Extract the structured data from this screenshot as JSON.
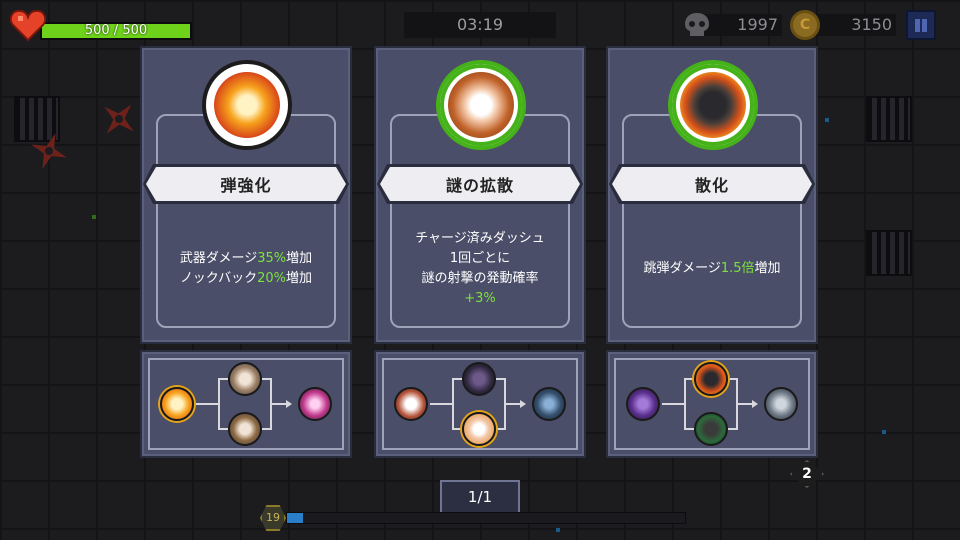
{
  "hud": {
    "hp_text": "500 / 500",
    "hp_fraction": 1.0,
    "timer": "03:19",
    "kills": "1997",
    "coins": "3150",
    "level": "19",
    "xp_fraction": 0.04
  },
  "colors": {
    "hp_green": "#6ed21b",
    "highlight_green": "#7de23c",
    "panel": "#4a4e68",
    "banner": "#eeeef2",
    "xp_blue": "#2a7fc8"
  },
  "cards": [
    {
      "title": "弾強化",
      "icon": "fist-explosion-icon",
      "desc_lines": [
        [
          {
            "t": "武器ダメージ"
          },
          {
            "t": "35%",
            "hl": true
          },
          {
            "t": "増加"
          }
        ],
        [
          {
            "t": "ノックバック"
          },
          {
            "t": "20%",
            "hl": true
          },
          {
            "t": "増加"
          }
        ]
      ],
      "evolution": {
        "from": "fist-explosion-icon",
        "mid_top": "brick-cat-icon",
        "mid_bottom": "cat-sword-icon",
        "result": "pink-slash-icon"
      }
    },
    {
      "title": "謎の拡散",
      "icon": "mystery-cat-icon",
      "desc_lines": [
        [
          {
            "t": "チャージ済みダッシュ"
          }
        ],
        [
          {
            "t": "1回ごとに"
          }
        ],
        [
          {
            "t": "謎の射撃の発動確率"
          }
        ],
        [
          {
            "t": "+3%",
            "hl": true
          }
        ]
      ],
      "evolution": {
        "from": "cat-gun-icon",
        "mid_top": "shadow-cat-icon",
        "mid_bottom": "mystery-cat-icon",
        "result": "ghost-cat-icon"
      }
    },
    {
      "title": "散化",
      "icon": "black-cat-wings-icon",
      "desc_lines": [
        [
          {
            "t": "跳弾ダメージ"
          },
          {
            "t": "1.5倍",
            "hl": true
          },
          {
            "t": "増加"
          }
        ]
      ],
      "evolution": {
        "from": "purple-cat-icon",
        "mid_top": "black-cat-wings-icon",
        "mid_bottom": "green-cat-icon",
        "result": "steel-shield-icon"
      }
    }
  ],
  "pagination": "1/1",
  "bg_badge": "2"
}
